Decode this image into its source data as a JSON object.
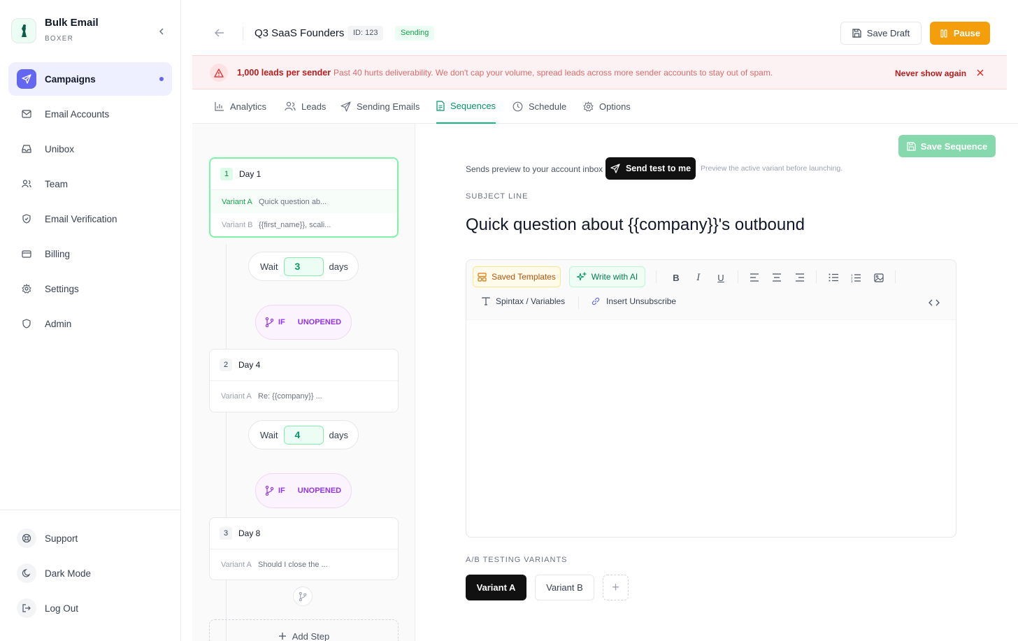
{
  "sidebar": {
    "brand_title": "Bulk Email",
    "brand_subtitle": "BOXER",
    "items": [
      {
        "label": "Campaigns",
        "icon": "send-icon",
        "active": true
      },
      {
        "label": "Email Accounts",
        "icon": "mail-icon"
      },
      {
        "label": "Unibox",
        "icon": "inbox-icon"
      },
      {
        "label": "Team",
        "icon": "users-icon"
      },
      {
        "label": "Email Verification",
        "icon": "shield-check-icon"
      },
      {
        "label": "Billing",
        "icon": "credit-card-icon"
      },
      {
        "label": "Settings",
        "icon": "gear-icon"
      },
      {
        "label": "Admin",
        "icon": "shield-icon"
      }
    ],
    "bottom": [
      {
        "label": "Support",
        "icon": "lifebuoy-icon"
      },
      {
        "label": "Dark Mode",
        "icon": "moon-icon"
      },
      {
        "label": "Log Out",
        "icon": "logout-icon"
      }
    ]
  },
  "header": {
    "title": "Q3 SaaS Founders",
    "id_badge": "ID: 123",
    "status": "Sending",
    "save_draft": "Save Draft",
    "pause": "Pause"
  },
  "alert": {
    "bold": "1,000 leads per sender",
    "text": "Past 40 hurts deliverability. We don't cap your volume, spread leads across more sender accounts to stay out of spam.",
    "dismiss": "Never show again"
  },
  "tabs": [
    "Analytics",
    "Leads",
    "Sending Emails",
    "Sequences",
    "Schedule",
    "Options"
  ],
  "active_tab": "Sequences",
  "steps": [
    {
      "num": "1",
      "day": "Day 1",
      "variants": [
        {
          "label": "Variant A",
          "text": "Quick question ab..."
        },
        {
          "label": "Variant B",
          "text": "{{first_name}}, scali..."
        }
      ]
    },
    {
      "num": "2",
      "day": "Day 4",
      "variants": [
        {
          "label": "Variant A",
          "text": "Re: {{company}} ..."
        }
      ]
    },
    {
      "num": "3",
      "day": "Day 8",
      "variants": [
        {
          "label": "Variant A",
          "text": "Should I close the ..."
        }
      ]
    }
  ],
  "waits": [
    {
      "label": "Wait",
      "value": "3",
      "unit": "days"
    },
    {
      "label": "Wait",
      "value": "4",
      "unit": "days"
    }
  ],
  "conditions": [
    {
      "if": "IF",
      "value": "UNOPENED"
    },
    {
      "if": "IF",
      "value": "UNOPENED"
    }
  ],
  "add_step": "Add Step",
  "editor": {
    "save_sequence": "Save Sequence",
    "preview_label": "Sends preview to your account inbox",
    "send_test": "Send test to me",
    "preview_hint": "Preview the active variant before launching.",
    "subject_label": "SUBJECT LINE",
    "subject": "Quick question about {{company}}'s outbound",
    "saved_templates": "Saved Templates",
    "write_ai": "Write with AI",
    "spintax": "Spintax / Variables",
    "insert_unsub": "Insert Unsubscribe",
    "ab_label": "A/B TESTING VARIANTS",
    "variant_a": "Variant A",
    "variant_b": "Variant B",
    "add_variant": "+"
  },
  "colors": {
    "accent_green": "#10b981",
    "pause_orange": "#f59e0b",
    "campaign_active": "#6366f1",
    "alert_red": "#b91c1c"
  }
}
